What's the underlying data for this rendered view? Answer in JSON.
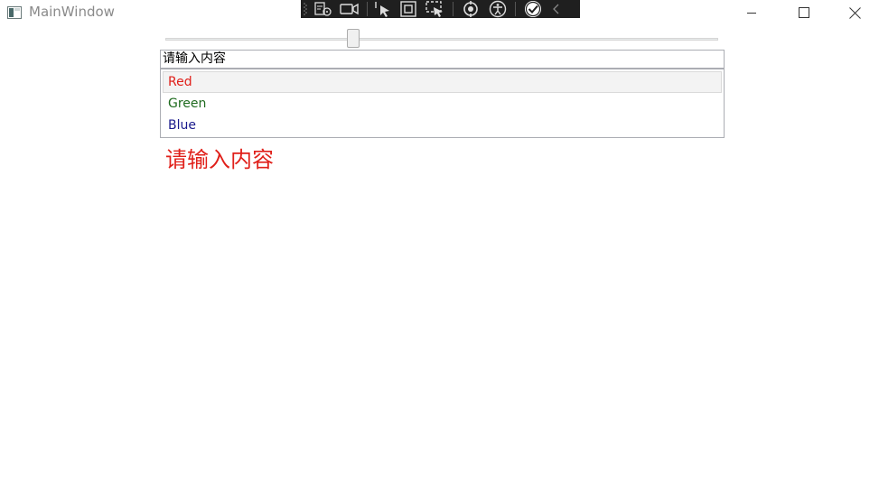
{
  "window": {
    "title": "MainWindow"
  },
  "debug_toolbar": {
    "buttons": [
      "select-element-icon",
      "video-icon",
      "pointer-icon",
      "display-layout-icon",
      "track-focus-icon",
      "hot-reload-icon",
      "accessibility-icon",
      "check-icon",
      "collapse-chevron-icon"
    ]
  },
  "slider": {
    "value": 0.34
  },
  "textbox": {
    "value": "请输入内容"
  },
  "listbox": {
    "items": [
      {
        "label": "Red",
        "color": "#e0201a",
        "selected": true
      },
      {
        "label": "Green",
        "color": "#1f6b1f",
        "selected": false
      },
      {
        "label": "Blue",
        "color": "#1a1a8c",
        "selected": false
      }
    ]
  },
  "display_text": {
    "value": "请输入内容",
    "color": "#e0201a"
  }
}
